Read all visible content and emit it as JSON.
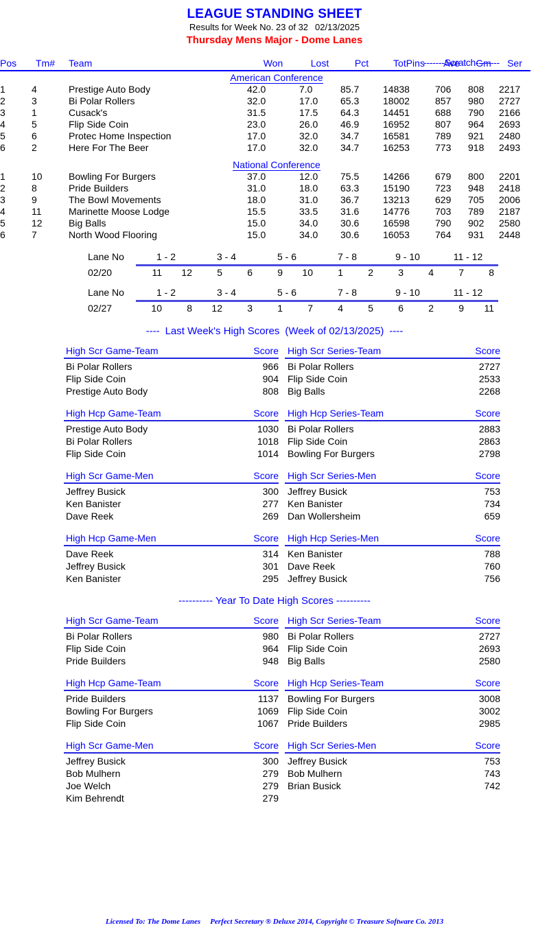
{
  "header": {
    "main_title": "LEAGUE STANDING SHEET",
    "results_prefix": "Results for Week No. 23 of 32",
    "results_date": "02/13/2025",
    "league_title": "Thursday Mens Major - Dome Lanes"
  },
  "standings": {
    "scratch_label": "-------Scratch--------",
    "columns": {
      "pos": "Pos",
      "tm": "Tm#",
      "team": "Team",
      "won": "Won",
      "lost": "Lost",
      "pct": "Pct",
      "totpins": "TotPins",
      "ave": "Ave",
      "gm": "Gm",
      "ser": "Ser"
    },
    "conferences": [
      {
        "name": "American Conference",
        "rows": [
          {
            "pos": "1",
            "tm": "4",
            "team": "Prestige Auto Body",
            "won": "42.0",
            "lost": "7.0",
            "pct": "85.7",
            "totpins": "14838",
            "ave": "706",
            "gm": "808",
            "ser": "2217"
          },
          {
            "pos": "2",
            "tm": "3",
            "team": "Bi Polar Rollers",
            "won": "32.0",
            "lost": "17.0",
            "pct": "65.3",
            "totpins": "18002",
            "ave": "857",
            "gm": "980",
            "ser": "2727"
          },
          {
            "pos": "3",
            "tm": "1",
            "team": "Cusack's",
            "won": "31.5",
            "lost": "17.5",
            "pct": "64.3",
            "totpins": "14451",
            "ave": "688",
            "gm": "790",
            "ser": "2166"
          },
          {
            "pos": "4",
            "tm": "5",
            "team": "Flip Side Coin",
            "won": "23.0",
            "lost": "26.0",
            "pct": "46.9",
            "totpins": "16952",
            "ave": "807",
            "gm": "964",
            "ser": "2693"
          },
          {
            "pos": "5",
            "tm": "6",
            "team": "Protec Home Inspection",
            "won": "17.0",
            "lost": "32.0",
            "pct": "34.7",
            "totpins": "16581",
            "ave": "789",
            "gm": "921",
            "ser": "2480"
          },
          {
            "pos": "6",
            "tm": "2",
            "team": "Here For The Beer",
            "won": "17.0",
            "lost": "32.0",
            "pct": "34.7",
            "totpins": "16253",
            "ave": "773",
            "gm": "918",
            "ser": "2493"
          }
        ]
      },
      {
        "name": "National Conference",
        "rows": [
          {
            "pos": "1",
            "tm": "10",
            "team": "Bowling For Burgers",
            "won": "37.0",
            "lost": "12.0",
            "pct": "75.5",
            "totpins": "14266",
            "ave": "679",
            "gm": "800",
            "ser": "2201"
          },
          {
            "pos": "2",
            "tm": "8",
            "team": "Pride Builders",
            "won": "31.0",
            "lost": "18.0",
            "pct": "63.3",
            "totpins": "15190",
            "ave": "723",
            "gm": "948",
            "ser": "2418"
          },
          {
            "pos": "3",
            "tm": "9",
            "team": "The Bowl Movements",
            "won": "18.0",
            "lost": "31.0",
            "pct": "36.7",
            "totpins": "13213",
            "ave": "629",
            "gm": "705",
            "ser": "2006"
          },
          {
            "pos": "4",
            "tm": "11",
            "team": "Marinette Moose Lodge",
            "won": "15.5",
            "lost": "33.5",
            "pct": "31.6",
            "totpins": "14776",
            "ave": "703",
            "gm": "789",
            "ser": "2187"
          },
          {
            "pos": "5",
            "tm": "12",
            "team": "Big Balls",
            "won": "15.0",
            "lost": "34.0",
            "pct": "30.6",
            "totpins": "16598",
            "ave": "790",
            "gm": "902",
            "ser": "2580"
          },
          {
            "pos": "6",
            "tm": "7",
            "team": "North Wood Flooring",
            "won": "15.0",
            "lost": "34.0",
            "pct": "30.6",
            "totpins": "16053",
            "ave": "764",
            "gm": "931",
            "ser": "2448"
          }
        ]
      }
    ]
  },
  "lane_schedule": {
    "lane_label": "Lane No",
    "lane_pairs": [
      "1 - 2",
      "3 - 4",
      "5 - 6",
      "7 - 8",
      "9 - 10",
      "11 - 12"
    ],
    "weeks": [
      {
        "date": "02/20",
        "teams": [
          "11",
          "12",
          "5",
          "6",
          "9",
          "10",
          "1",
          "2",
          "3",
          "4",
          "7",
          "8"
        ]
      },
      {
        "date": "02/27",
        "teams": [
          "10",
          "8",
          "12",
          "3",
          "1",
          "7",
          "4",
          "5",
          "6",
          "2",
          "9",
          "11"
        ]
      }
    ]
  },
  "last_week": {
    "banner_left": "----",
    "banner_text": "Last Week's High Scores",
    "banner_week": "(Week of 02/13/2025)",
    "banner_right": "----",
    "score_label": "Score",
    "groups": [
      {
        "left_title": "High Scr Game-Team",
        "right_title": "High Scr Series-Team",
        "left_rows": [
          {
            "name": "Bi Polar Rollers",
            "score": "966"
          },
          {
            "name": "Flip Side Coin",
            "score": "904"
          },
          {
            "name": "Prestige Auto Body",
            "score": "808"
          }
        ],
        "right_rows": [
          {
            "name": "Bi Polar Rollers",
            "score": "2727"
          },
          {
            "name": "Flip Side Coin",
            "score": "2533"
          },
          {
            "name": "Big Balls",
            "score": "2268"
          }
        ]
      },
      {
        "left_title": "High Hcp Game-Team",
        "right_title": "High Hcp Series-Team",
        "left_rows": [
          {
            "name": "Prestige Auto Body",
            "score": "1030"
          },
          {
            "name": "Bi Polar Rollers",
            "score": "1018"
          },
          {
            "name": "Flip Side Coin",
            "score": "1014"
          }
        ],
        "right_rows": [
          {
            "name": "Bi Polar Rollers",
            "score": "2883"
          },
          {
            "name": "Flip Side Coin",
            "score": "2863"
          },
          {
            "name": "Bowling For Burgers",
            "score": "2798"
          }
        ]
      },
      {
        "left_title": "High Scr Game-Men",
        "right_title": "High Scr Series-Men",
        "left_rows": [
          {
            "name": "Jeffrey Busick",
            "score": "300"
          },
          {
            "name": "Ken Banister",
            "score": "277"
          },
          {
            "name": "Dave Reek",
            "score": "269"
          }
        ],
        "right_rows": [
          {
            "name": "Jeffrey Busick",
            "score": "753"
          },
          {
            "name": "Ken Banister",
            "score": "734"
          },
          {
            "name": "Dan Wollersheim",
            "score": "659"
          }
        ]
      },
      {
        "left_title": "High Hcp Game-Men",
        "right_title": "High Hcp Series-Men",
        "left_rows": [
          {
            "name": "Dave Reek",
            "score": "314"
          },
          {
            "name": "Jeffrey Busick",
            "score": "301"
          },
          {
            "name": "Ken Banister",
            "score": "295"
          }
        ],
        "right_rows": [
          {
            "name": "Ken Banister",
            "score": "788"
          },
          {
            "name": "Dave Reek",
            "score": "760"
          },
          {
            "name": "Jeffrey Busick",
            "score": "756"
          }
        ]
      }
    ]
  },
  "year_to_date": {
    "banner_text": "---------- Year To Date High Scores ----------",
    "score_label": "Score",
    "groups": [
      {
        "left_title": "High Scr Game-Team",
        "right_title": "High Scr Series-Team",
        "left_rows": [
          {
            "name": "Bi Polar Rollers",
            "score": "980"
          },
          {
            "name": "Flip Side Coin",
            "score": "964"
          },
          {
            "name": "Pride Builders",
            "score": "948"
          }
        ],
        "right_rows": [
          {
            "name": "Bi Polar Rollers",
            "score": "2727"
          },
          {
            "name": "Flip Side Coin",
            "score": "2693"
          },
          {
            "name": "Big Balls",
            "score": "2580"
          }
        ]
      },
      {
        "left_title": "High Hcp Game-Team",
        "right_title": "High Hcp Series-Team",
        "left_rows": [
          {
            "name": "Pride Builders",
            "score": "1137"
          },
          {
            "name": "Bowling For Burgers",
            "score": "1069"
          },
          {
            "name": "Flip Side Coin",
            "score": "1067"
          }
        ],
        "right_rows": [
          {
            "name": "Bowling For Burgers",
            "score": "3008"
          },
          {
            "name": "Flip Side Coin",
            "score": "3002"
          },
          {
            "name": "Pride Builders",
            "score": "2985"
          }
        ]
      },
      {
        "left_title": "High Scr Game-Men",
        "right_title": "High Scr Series-Men",
        "left_rows": [
          {
            "name": "Jeffrey Busick",
            "score": "300"
          },
          {
            "name": "Bob Mulhern",
            "score": "279"
          },
          {
            "name": "Joe Welch",
            "score": "279"
          },
          {
            "name": "Kim Behrendt",
            "score": "279"
          }
        ],
        "right_rows": [
          {
            "name": "Jeffrey Busick",
            "score": "753"
          },
          {
            "name": "Bob Mulhern",
            "score": "743"
          },
          {
            "name": "Brian Busick",
            "score": "742"
          }
        ]
      }
    ]
  },
  "footer": {
    "licensed_to": "Licensed To: The Dome Lanes",
    "software": "Perfect Secretary ® Deluxe  2014, Copyright © Treasure Software Co. 2013"
  },
  "colors": {
    "accent_blue": "#0000ff",
    "league_red": "#ff0000",
    "rule_blue": "#4a4ae0"
  }
}
